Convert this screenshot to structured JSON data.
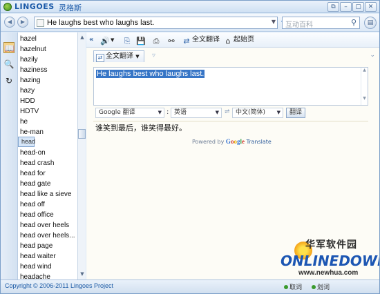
{
  "title_bar": {
    "app_name": "LINGOES",
    "app_name_cn": "灵格斯",
    "controls": [
      "restore",
      "minimize",
      "maximize",
      "close"
    ]
  },
  "address_bar": {
    "query": "He laughs best who laughs last.",
    "search_placeholder": "互动百科"
  },
  "word_list": {
    "items": [
      "hazel",
      "hazelnut",
      "hazily",
      "haziness",
      "hazing",
      "hazy",
      "HDD",
      "HDTV",
      "he",
      "he-man",
      "head",
      "head-on",
      "head crash",
      "head for",
      "head gate",
      "head like a sieve",
      "head off",
      "head office",
      "head over heels",
      "head over heels...",
      "head page",
      "head waiter",
      "head wind",
      "headache"
    ],
    "selected": "head"
  },
  "toolbar": {
    "full_translate": "全文翻译",
    "home_page": "起始页"
  },
  "tab": {
    "label": "全文翻译"
  },
  "translation": {
    "source_text": "He laughs best who laughs last.",
    "engine": "Google 翻译",
    "from_lang": "英语",
    "to_lang": "中文(简体)",
    "translate_button": "翻译",
    "result": "谁笑到最后，谁笑得最好。",
    "powered_by": "Powered by",
    "google_letters": [
      "G",
      "o",
      "o",
      "g",
      "l",
      "e"
    ],
    "translate_suffix": "Translate"
  },
  "watermark": {
    "cn": "华军软件园",
    "brand": "ONLINEDOWN",
    "url": "www.newhua.com"
  },
  "status_bar": {
    "copyright": "Copyright © 2006-2011 Lingoes Project",
    "item1": "取词",
    "item2": "划词"
  },
  "colors": {
    "accent": "#1c5aa8",
    "selection": "#3675c6",
    "window_bg": "#dce9f7"
  }
}
